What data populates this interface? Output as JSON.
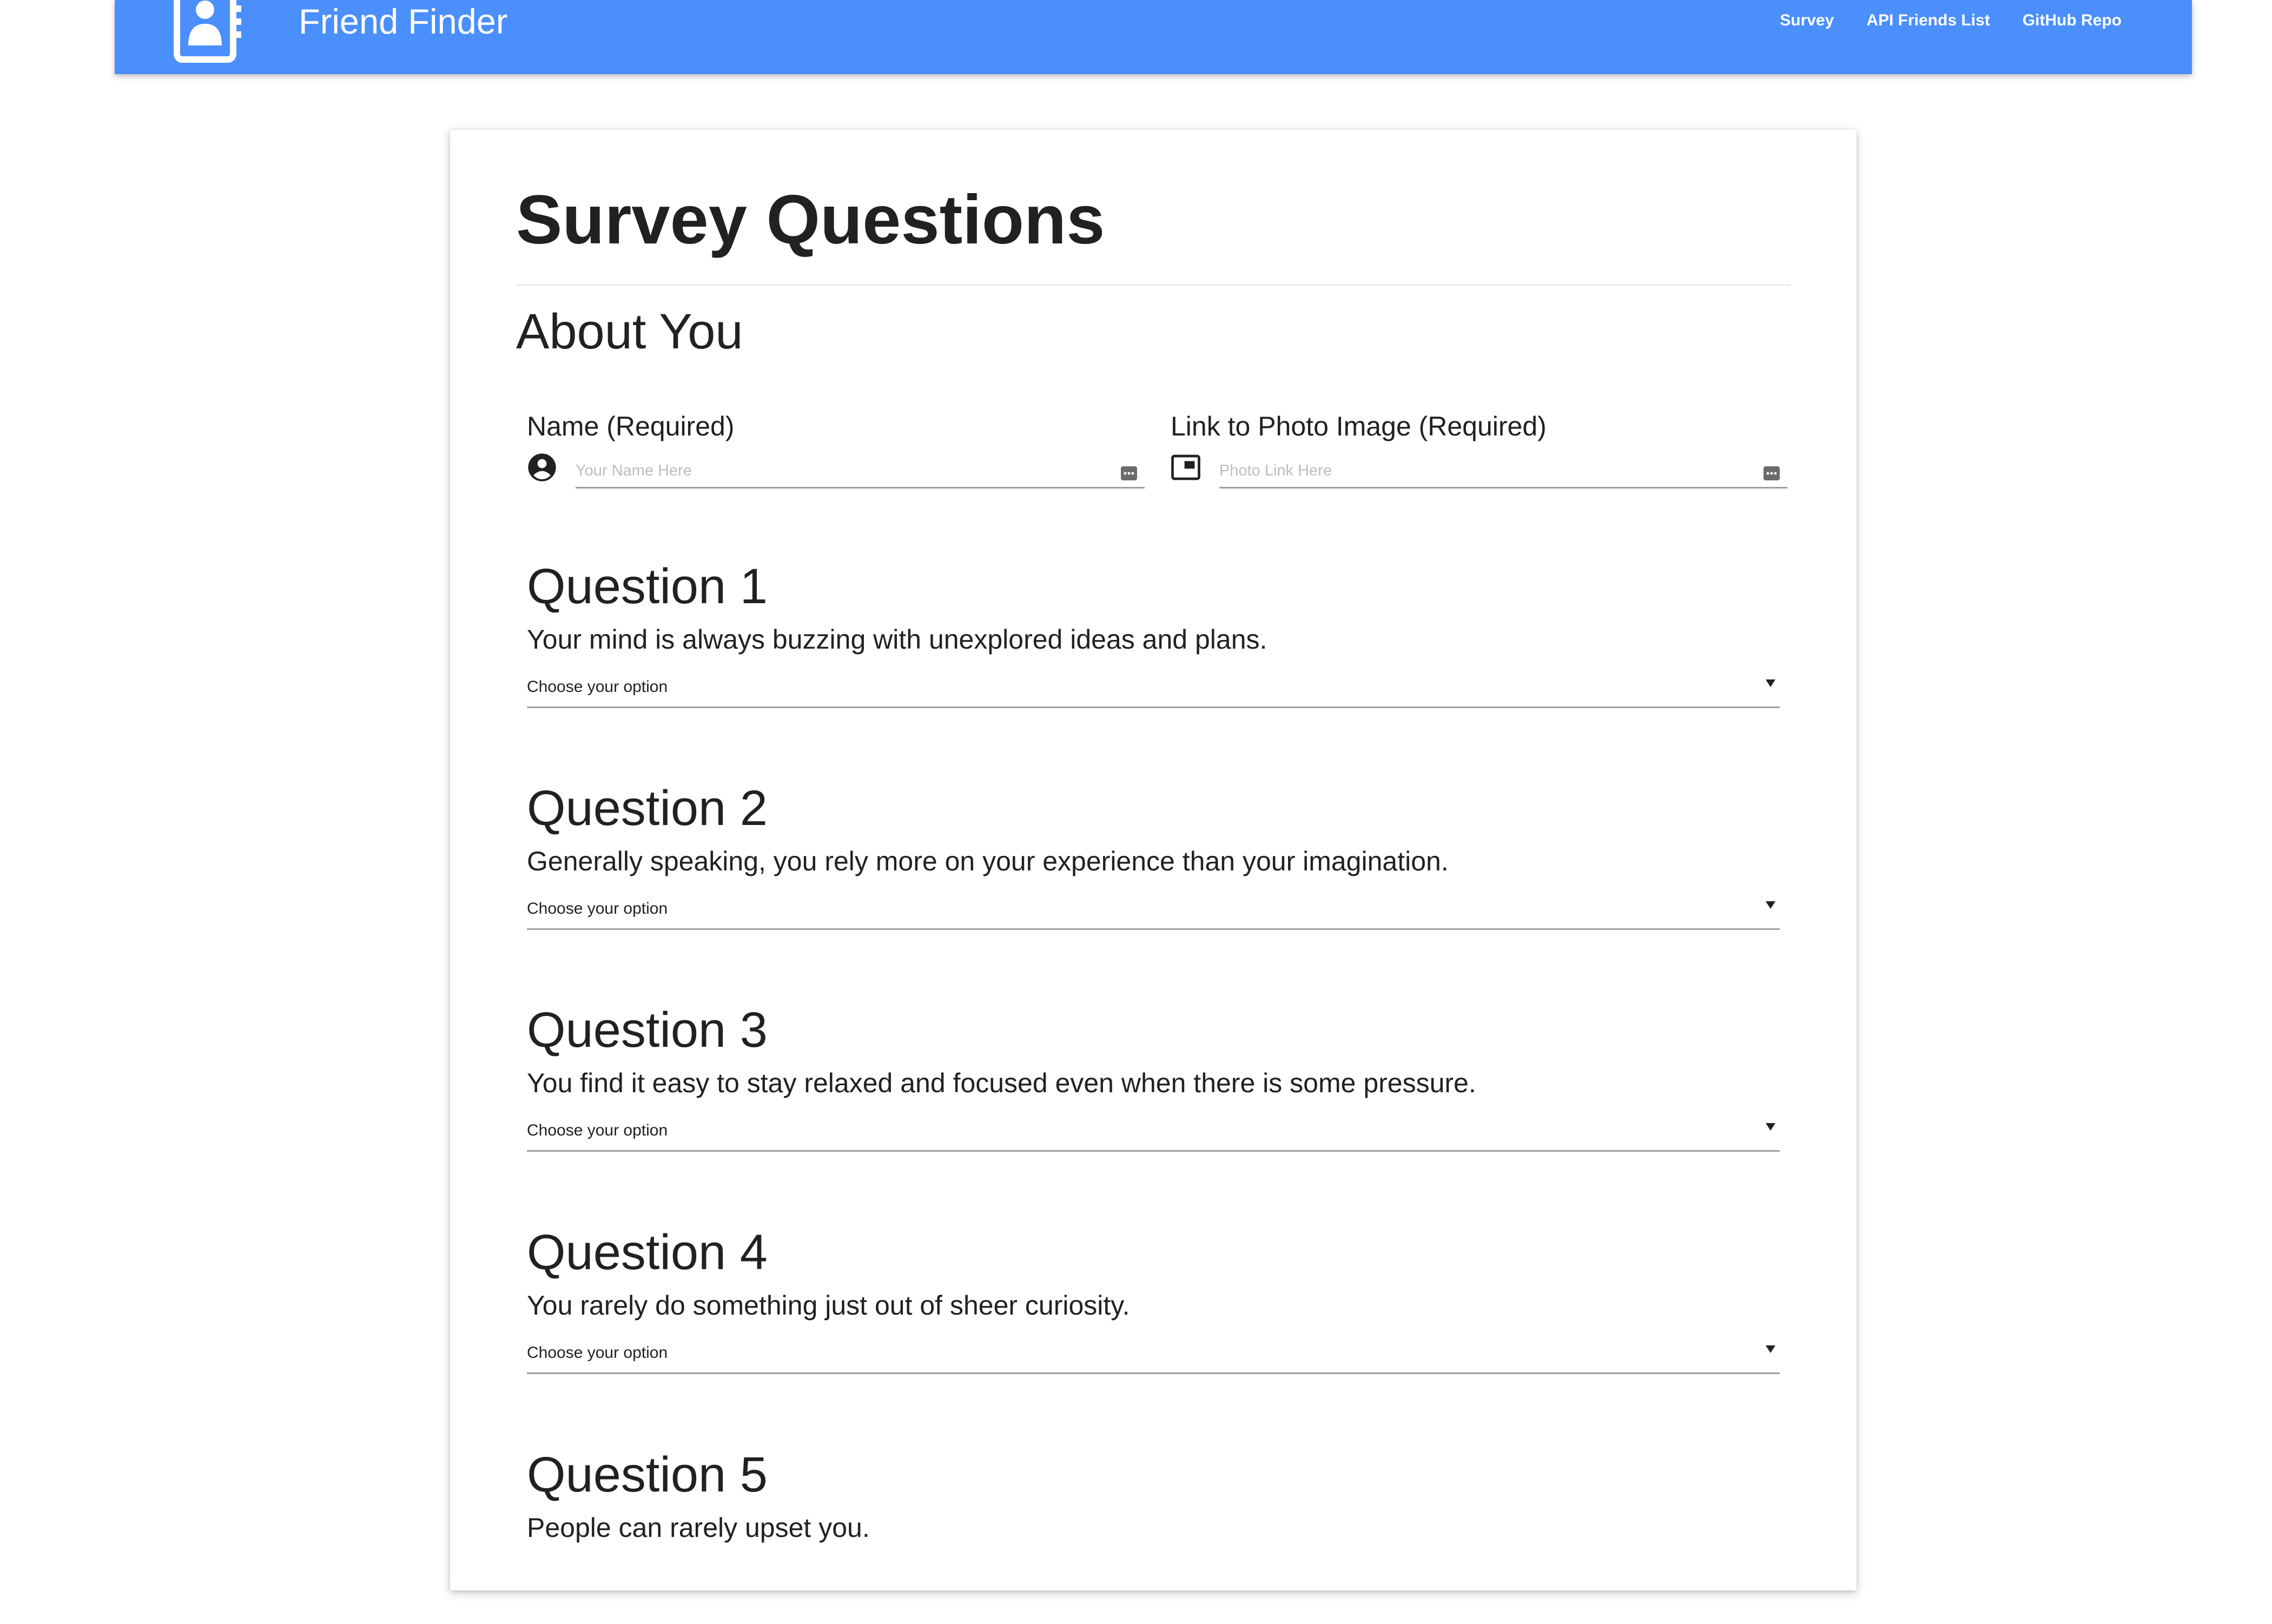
{
  "navbar": {
    "brand": "Friend Finder",
    "links": [
      "Survey",
      "API Friends List",
      "GitHub Repo"
    ],
    "color": "#4a8ffb"
  },
  "card": {
    "title": "Survey Questions",
    "section": "About You",
    "name_field": {
      "label": "Name (Required)",
      "placeholder": "Your Name Here",
      "icon": "account-circle-icon"
    },
    "photo_field": {
      "label": "Link to Photo Image (Required)",
      "placeholder": "Photo Link Here",
      "icon": "picture-in-picture-icon"
    },
    "questions": [
      {
        "title": "Question 1",
        "text": "Your mind is always buzzing with unexplored ideas and plans.",
        "select": "Choose your option"
      },
      {
        "title": "Question 2",
        "text": "Generally speaking, you rely more on your experience than your imagination.",
        "select": "Choose your option"
      },
      {
        "title": "Question 3",
        "text": "You find it easy to stay relaxed and focused even when there is some pressure.",
        "select": "Choose your option"
      },
      {
        "title": "Question 4",
        "text": "You rarely do something just out of sheer curiosity.",
        "select": "Choose your option"
      },
      {
        "title": "Question 5",
        "text": "People can rarely upset you."
      }
    ]
  }
}
